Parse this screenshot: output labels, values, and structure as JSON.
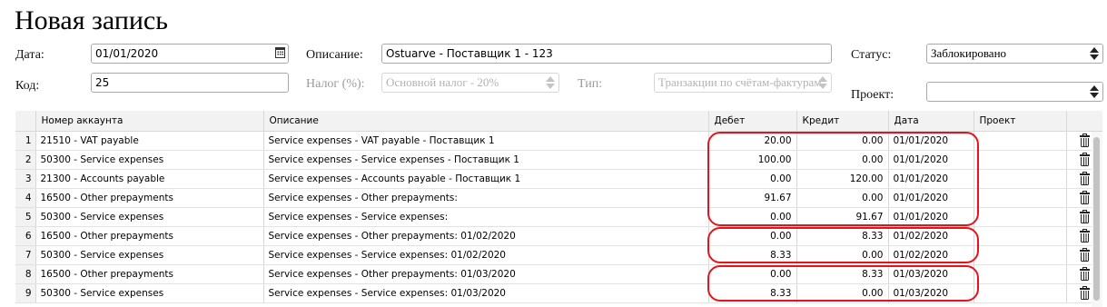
{
  "page": {
    "title": "Новая запись"
  },
  "form": {
    "date_label": "Дата:",
    "date_value": "01/01/2020",
    "code_label": "Код:",
    "code_value": "25",
    "desc_label": "Описание:",
    "desc_value": "Ostuarve - Поставщик 1 - 123",
    "tax_label": "Налог (%):",
    "tax_value": "Основной налог - 20%",
    "type_label": "Тип:",
    "type_value": "Транзакции по счётам-фактурам",
    "status_label": "Статус:",
    "status_value": "Заблокировано",
    "project_label": "Проект:",
    "project_value": ""
  },
  "table": {
    "headers": [
      "",
      "Номер аккаунта",
      "Описание",
      "Дебет",
      "Кредит",
      "Дата",
      "Проект",
      ""
    ],
    "rows": [
      {
        "n": "1",
        "account": "21510 - VAT payable",
        "desc": "Service expenses - VAT payable - Поставщик 1",
        "debit": "20.00",
        "credit": "0.00",
        "date": "01/01/2020",
        "project": ""
      },
      {
        "n": "2",
        "account": "50300 - Service expenses",
        "desc": "Service expenses - Service expenses - Поставщик 1",
        "debit": "100.00",
        "credit": "0.00",
        "date": "01/01/2020",
        "project": ""
      },
      {
        "n": "3",
        "account": "21300 - Accounts payable",
        "desc": "Service expenses - Accounts payable - Поставщик 1",
        "debit": "0.00",
        "credit": "120.00",
        "date": "01/01/2020",
        "project": ""
      },
      {
        "n": "4",
        "account": "16500 - Other prepayments",
        "desc": "Service expenses - Other prepayments:",
        "debit": "91.67",
        "credit": "0.00",
        "date": "01/01/2020",
        "project": ""
      },
      {
        "n": "5",
        "account": "50300 - Service expenses",
        "desc": "Service expenses - Service expenses:",
        "debit": "0.00",
        "credit": "91.67",
        "date": "01/01/2020",
        "project": ""
      },
      {
        "n": "6",
        "account": "16500 - Other prepayments",
        "desc": "Service expenses - Other prepayments: 01/02/2020",
        "debit": "0.00",
        "credit": "8.33",
        "date": "01/02/2020",
        "project": ""
      },
      {
        "n": "7",
        "account": "50300 - Service expenses",
        "desc": "Service expenses - Service expenses: 01/02/2020",
        "debit": "8.33",
        "credit": "0.00",
        "date": "01/02/2020",
        "project": ""
      },
      {
        "n": "8",
        "account": "16500 - Other prepayments",
        "desc": "Service expenses - Other prepayments: 01/03/2020",
        "debit": "0.00",
        "credit": "8.33",
        "date": "01/03/2020",
        "project": ""
      },
      {
        "n": "9",
        "account": "50300 - Service expenses",
        "desc": "Service expenses - Service expenses: 01/03/2020",
        "debit": "8.33",
        "credit": "0.00",
        "date": "01/03/2020",
        "project": ""
      }
    ]
  },
  "icons": {
    "calendar": "calendar-icon",
    "select": "select-arrows-icon",
    "delete": "trash-icon"
  },
  "colors": {
    "highlight": "#e2151b",
    "header_bg": "#f2f2f2"
  }
}
